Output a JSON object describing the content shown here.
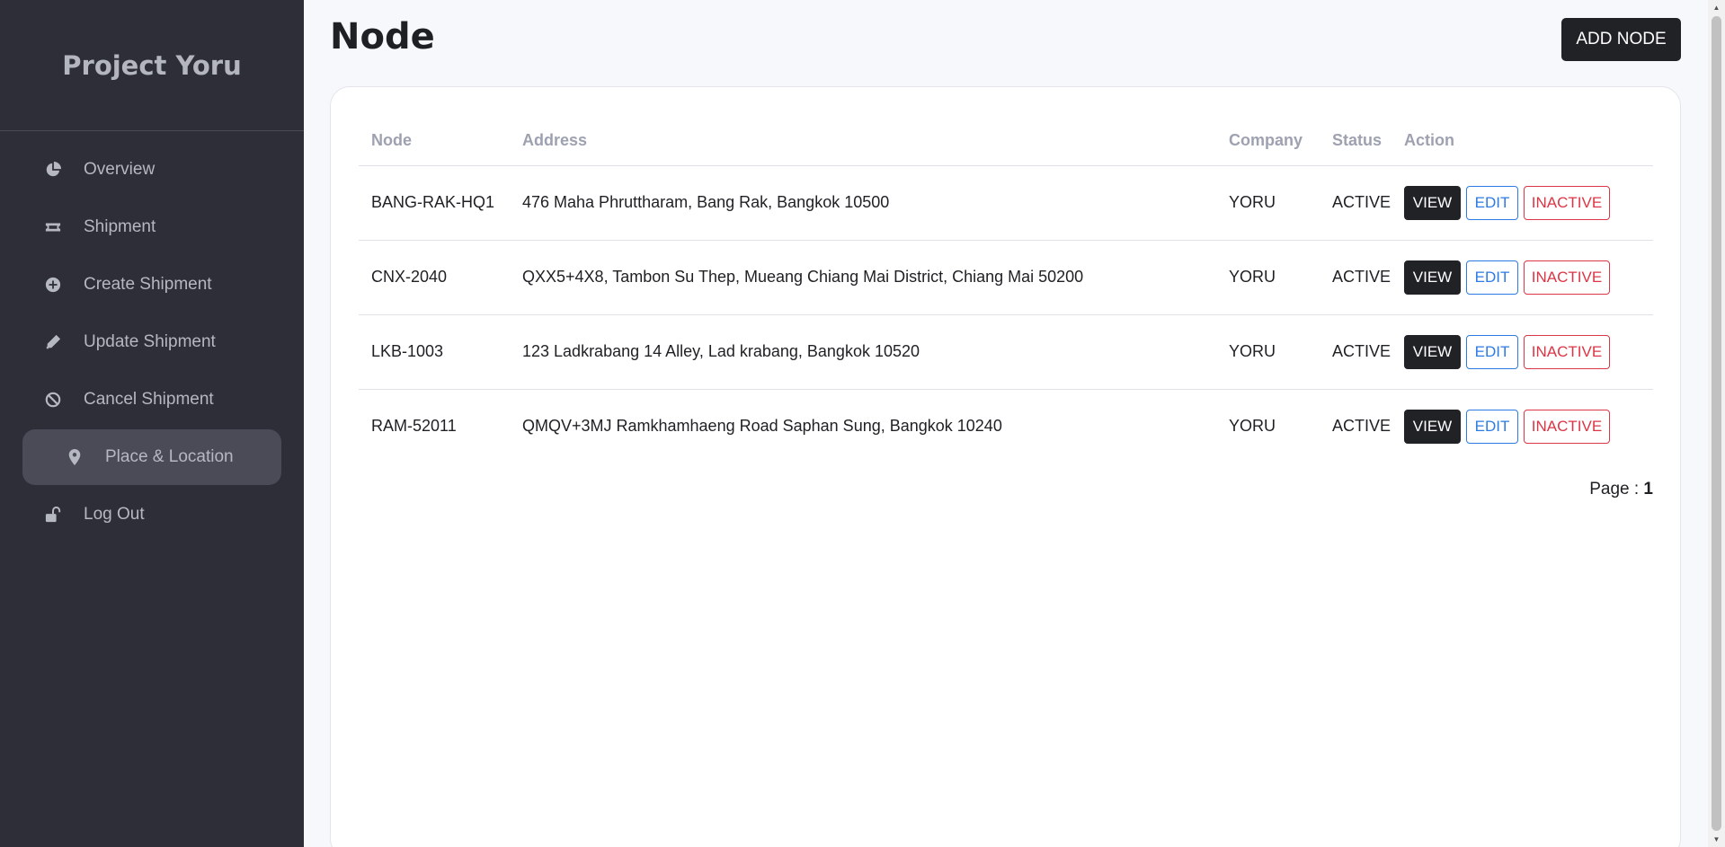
{
  "app": {
    "title": "Project Yoru"
  },
  "sidebar": {
    "items": [
      {
        "label": "Overview",
        "icon": "pie-chart-icon"
      },
      {
        "label": "Shipment",
        "icon": "ticket-icon"
      },
      {
        "label": "Create Shipment",
        "icon": "plus-circle-icon"
      },
      {
        "label": "Update Shipment",
        "icon": "pencil-icon"
      },
      {
        "label": "Cancel Shipment",
        "icon": "ban-icon"
      },
      {
        "label": "Place & Location",
        "icon": "map-pin-icon",
        "active": true
      },
      {
        "label": "Log Out",
        "icon": "unlock-icon"
      }
    ]
  },
  "header": {
    "title": "Node",
    "add_label": "ADD NODE"
  },
  "table": {
    "columns": [
      "Node",
      "Address",
      "Company",
      "Status",
      "Action"
    ],
    "rows": [
      {
        "node": "BANG-RAK-HQ1",
        "address": "476 Maha Phruttharam, Bang Rak, Bangkok 10500",
        "company": "YORU",
        "status": "ACTIVE"
      },
      {
        "node": "CNX-2040",
        "address": "QXX5+4X8, Tambon Su Thep, Mueang Chiang Mai District, Chiang Mai 50200",
        "company": "YORU",
        "status": "ACTIVE"
      },
      {
        "node": "LKB-1003",
        "address": "123 Ladkrabang 14 Alley, Lad krabang, Bangkok 10520",
        "company": "YORU",
        "status": "ACTIVE"
      },
      {
        "node": "RAM-52011",
        "address": "QMQV+3MJ Ramkhamhaeng Road Saphan Sung, Bangkok 10240",
        "company": "YORU",
        "status": "ACTIVE"
      }
    ],
    "actions": {
      "view": "VIEW",
      "edit": "EDIT",
      "inactive": "INACTIVE"
    }
  },
  "pager": {
    "label": "Page :",
    "page": "1"
  },
  "colors": {
    "sidebar_bg": "#2d2e38",
    "active_item_bg": "#4a4b57",
    "edit": "#2c7be5",
    "inactive": "#dc3545",
    "dark_btn": "#202226"
  }
}
